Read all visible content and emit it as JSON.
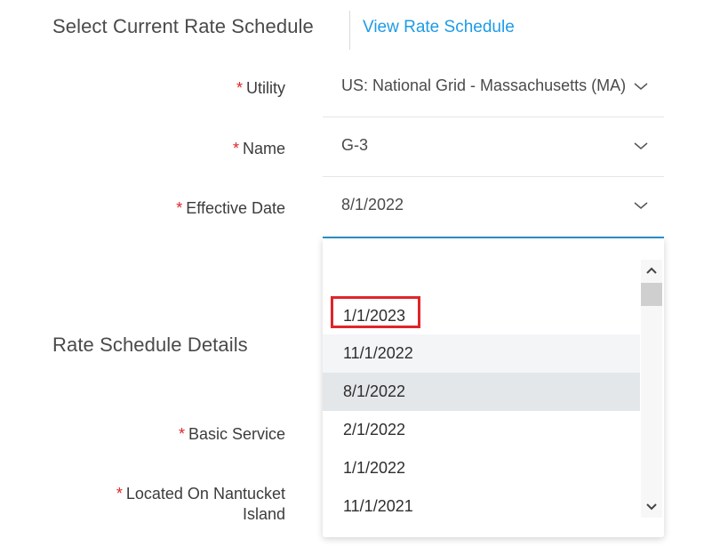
{
  "header": {
    "title": "Select Current Rate Schedule",
    "link": "View Rate Schedule"
  },
  "form": {
    "required_mark": "*",
    "utility": {
      "label": "Utility",
      "value": "US: National Grid - Massachusetts (MA)"
    },
    "name": {
      "label": "Name",
      "value": "G-3"
    },
    "effective_date": {
      "label": "Effective Date",
      "value": "8/1/2022"
    }
  },
  "details": {
    "title": "Rate Schedule Details",
    "basic_service": {
      "label": "Basic Service"
    },
    "nantucket": {
      "label_line1": "Located On Nantucket",
      "label_line2": "Island"
    }
  },
  "dropdown": {
    "options": [
      "1/1/2023",
      "11/1/2022",
      "8/1/2022",
      "2/1/2022",
      "1/1/2022",
      "11/1/2021"
    ],
    "selected": "8/1/2022",
    "highlighted": "1/1/2023"
  },
  "colors": {
    "accent": "#1e9be6",
    "required": "#e0242a",
    "active_border": "#2b93c9"
  }
}
